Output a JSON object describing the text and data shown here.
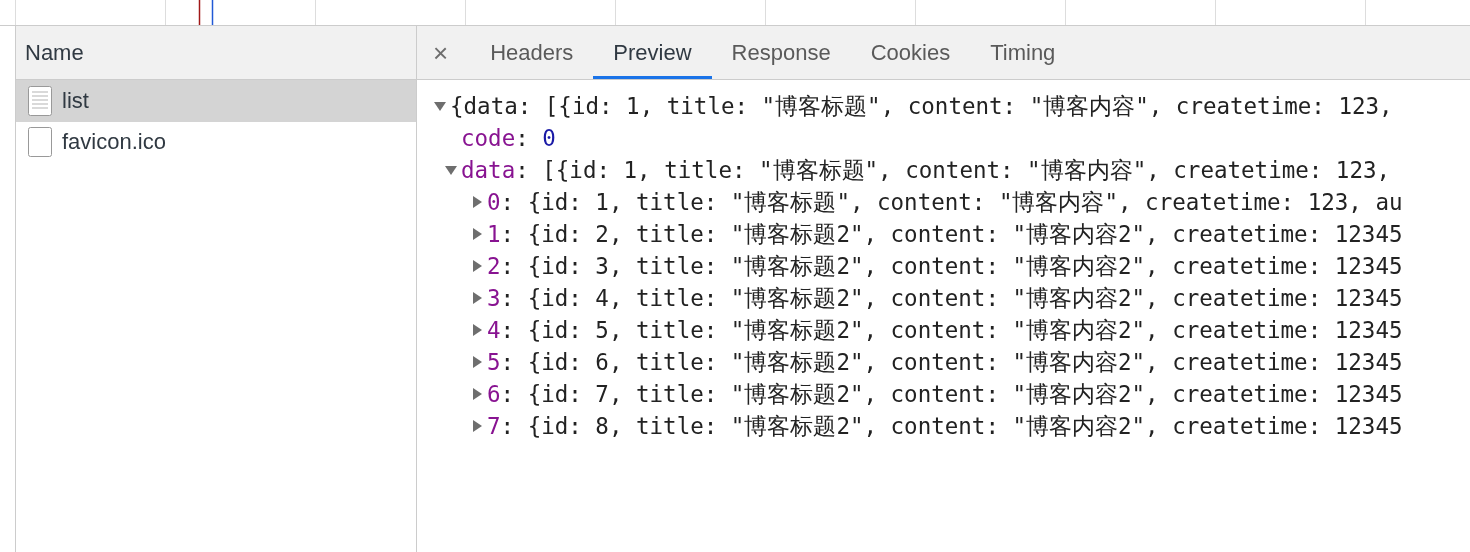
{
  "name_panel": {
    "header": "Name",
    "requests": [
      {
        "name": "list",
        "kind": "document",
        "selected": true
      },
      {
        "name": "favicon.ico",
        "kind": "blank",
        "selected": false
      }
    ]
  },
  "detail_tabs": {
    "close": "×",
    "tabs": [
      {
        "label": "Headers",
        "selected": false
      },
      {
        "label": "Preview",
        "selected": true
      },
      {
        "label": "Response",
        "selected": false
      },
      {
        "label": "Cookies",
        "selected": false
      },
      {
        "label": "Timing",
        "selected": false
      }
    ]
  },
  "preview": {
    "separator": ": ",
    "root": {
      "summary": "{data: [{id: 1, title: \"博客标题\", content: \"博客内容\", createtime: 123,",
      "expanded": true,
      "children": [
        {
          "key": "code",
          "value": "0",
          "kind": "number"
        },
        {
          "key": "data",
          "summary": "[{id: 1, title: \"博客标题\", content: \"博客内容\", createtime: 123,",
          "expanded": true,
          "children": [
            {
              "key": "0",
              "summary": "{id: 1, title: \"博客标题\", content: \"博客内容\", createtime: 123, au",
              "expanded": false
            },
            {
              "key": "1",
              "summary": "{id: 2, title: \"博客标题2\", content: \"博客内容2\", createtime: 12345",
              "expanded": false
            },
            {
              "key": "2",
              "summary": "{id: 3, title: \"博客标题2\", content: \"博客内容2\", createtime: 12345",
              "expanded": false
            },
            {
              "key": "3",
              "summary": "{id: 4, title: \"博客标题2\", content: \"博客内容2\", createtime: 12345",
              "expanded": false
            },
            {
              "key": "4",
              "summary": "{id: 5, title: \"博客标题2\", content: \"博客内容2\", createtime: 12345",
              "expanded": false
            },
            {
              "key": "5",
              "summary": "{id: 6, title: \"博客标题2\", content: \"博客内容2\", createtime: 12345",
              "expanded": false
            },
            {
              "key": "6",
              "summary": "{id: 7, title: \"博客标题2\", content: \"博客内容2\", createtime: 12345",
              "expanded": false
            },
            {
              "key": "7",
              "summary": "{id: 8, title: \"博客标题2\", content: \"博客内容2\", createtime: 12345",
              "expanded": false
            }
          ]
        }
      ]
    }
  }
}
